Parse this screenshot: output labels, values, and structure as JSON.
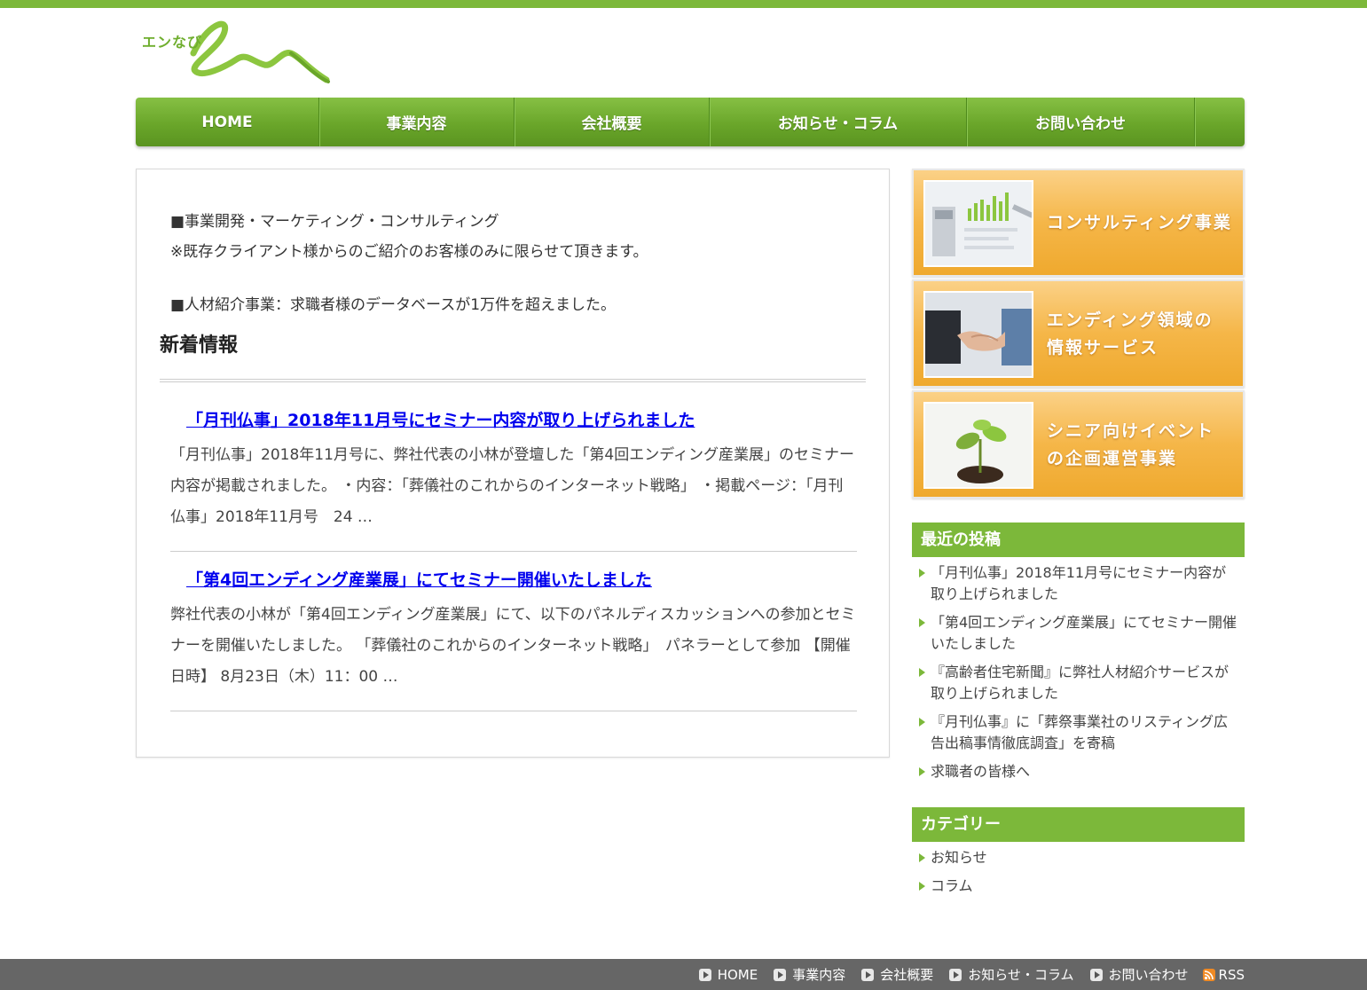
{
  "header": {
    "logo_text": "エンなび"
  },
  "nav": {
    "items": [
      {
        "label": "HOME"
      },
      {
        "label": "事業内容"
      },
      {
        "label": "会社概要"
      },
      {
        "label": "お知らせ・コラム"
      },
      {
        "label": "お問い合わせ"
      }
    ]
  },
  "main": {
    "intro": {
      "line1": "■事業開発・マーケティング・コンサルティング",
      "line2": "※既存クライアント様からのご紹介のお客様のみに限らせて頂きます。",
      "line3": "■人材紹介事業：求職者様のデータベースが1万件を超えました。"
    },
    "news_title": "新着情報",
    "posts": [
      {
        "title": "「月刊仏事」2018年11月号にセミナー内容が取り上げられました",
        "excerpt": "「月刊仏事」2018年11月号に、弊社代表の小林が登壇した「第4回エンディング産業展」のセミナー内容が掲載されました。 ・内容：「葬儀社のこれからのインターネット戦略」 ・掲載ページ：「月刊仏事」2018年11月号　24 …"
      },
      {
        "title": "「第4回エンディング産業展」にてセミナー開催いたしました",
        "excerpt": "弊社代表の小林が「第4回エンディング産業展」にて、以下のパネルディスカッションへの参加とセミナーを開催いたしました。 「葬儀社のこれからのインターネット戦略」　パネラーとして参加 【開催日時】 8月23日（木）11：00 …"
      }
    ]
  },
  "sidebar": {
    "banners": [
      {
        "line1": "コンサルティング事業",
        "line2": ""
      },
      {
        "line1": "エンディング領域の",
        "line2": "情報サービス"
      },
      {
        "line1": "シニア向けイベント",
        "line2": "の企画運営事業"
      }
    ],
    "recent_title": "最近の投稿",
    "recent_posts": [
      "「月刊仏事」2018年11月号にセミナー内容が取り上げられました",
      "「第4回エンディング産業展」にてセミナー開催いたしました",
      "『高齢者住宅新聞』に弊社人材紹介サービスが取り上げられました",
      "『月刊仏事』に「葬祭事業社のリスティング広告出稿事情徹底調査」を寄稿",
      "求職者の皆様へ"
    ],
    "category_title": "カテゴリー",
    "categories": [
      "お知らせ",
      "コラム"
    ]
  },
  "footer": {
    "links": [
      "HOME",
      "事業内容",
      "会社概要",
      "お知らせ・コラム",
      "お問い合わせ"
    ],
    "rss": "RSS"
  },
  "colors": {
    "brand_green": "#7cb83a",
    "banner_orange": "#f5b648",
    "footer_gray": "#666666",
    "link_blue": "#0000ee"
  }
}
